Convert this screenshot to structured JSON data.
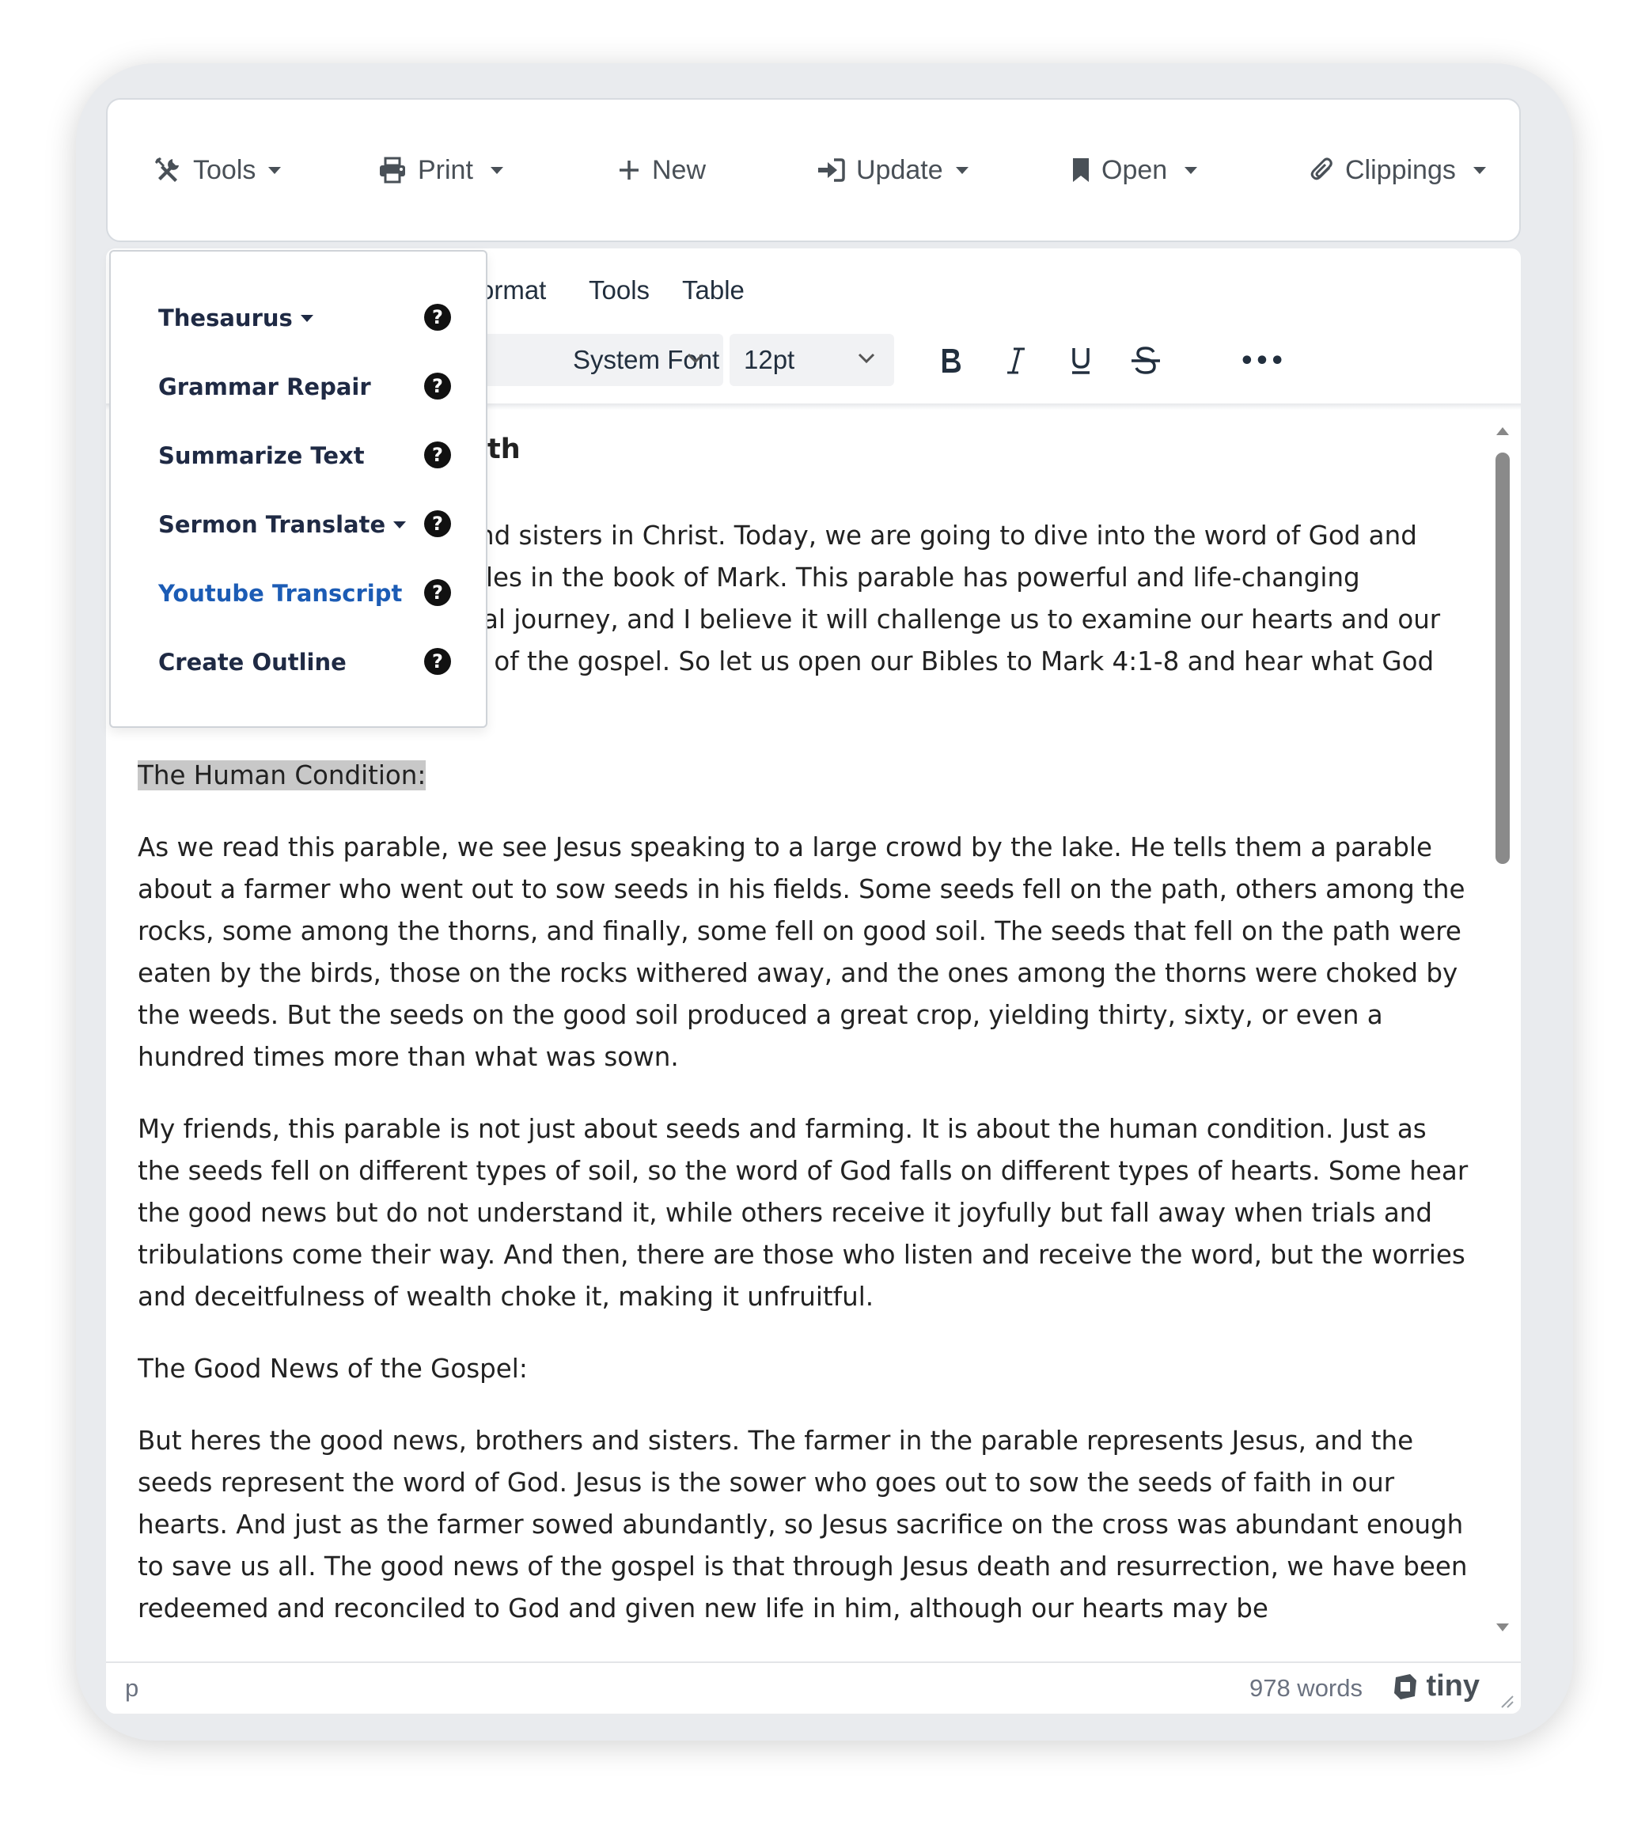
{
  "navbar": {
    "tools": "Tools",
    "print": "Print",
    "new": "New",
    "update": "Update",
    "open": "Open",
    "clippings": "Clippings"
  },
  "menubar": {
    "format_partial": "ormat",
    "tools": "Tools",
    "table": "Table"
  },
  "toolbar": {
    "font_family": "System Font",
    "font_size": "12pt",
    "more": "•••"
  },
  "dropdown": {
    "items": [
      {
        "label": "Thesaurus",
        "has_caret": true
      },
      {
        "label": "Grammar Repair",
        "has_caret": false
      },
      {
        "label": "Summarize Text",
        "has_caret": false
      },
      {
        "label": "Sermon Translate",
        "has_caret": true
      },
      {
        "label": "Youtube Transcript",
        "has_caret": false,
        "active": true
      },
      {
        "label": "Create Outline",
        "has_caret": false
      }
    ],
    "help_glyph": "?"
  },
  "content": {
    "title_fragment": "ith",
    "intro_lines": [
      "nd sisters in Christ. Today, we are going to dive into the word of God and",
      "les in the book of Mark. This parable has powerful and life-changing",
      "al journey, and I believe it will challenge us to examine our hearts and our"
    ],
    "intro_rest": "response to the good news of the gospel. So let us open our Bibles to Mark 4:1-8 and hear what God has to say to us today.",
    "heading_1": "The Human Condition:",
    "para_1": "As we read this parable, we see Jesus speaking to a large crowd by the lake. He tells them a parable about a farmer who went out to sow seeds in his fields. Some seeds fell on the path, others among the rocks, some among the thorns, and finally, some fell on good soil. The seeds that fell on the path were eaten by the birds, those on the rocks withered away, and the ones among the thorns were choked by the weeds. But the seeds on the good soil produced a great crop, yielding thirty, sixty, or even a hundred times more than what was sown.",
    "para_2": "My friends, this parable is not just about seeds and farming. It is about the human condition. Just as the seeds fell on different types of soil, so the word of God falls on different types of hearts. Some hear the good news but do not understand it, while others receive it joyfully but fall away when trials and tribulations come their way. And then, there are those who listen and receive the word, but the worries and deceitfulness of wealth choke it, making it unfruitful.",
    "heading_2": "The Good News of the Gospel:",
    "para_3": "But heres the good news, brothers and sisters. The farmer in the parable represents Jesus, and the seeds represent the word of God. Jesus is the sower who goes out to sow the seeds of faith in our hearts. And just as the farmer sowed abundantly, so Jesus sacrifice on the cross was abundant enough to save us all. The good news of the gospel is that through Jesus death and resurrection, we have been redeemed and reconciled to God and given new life in him, although our hearts may be"
  },
  "statusbar": {
    "path": "p",
    "word_count": "978 words",
    "brand": "tiny"
  }
}
